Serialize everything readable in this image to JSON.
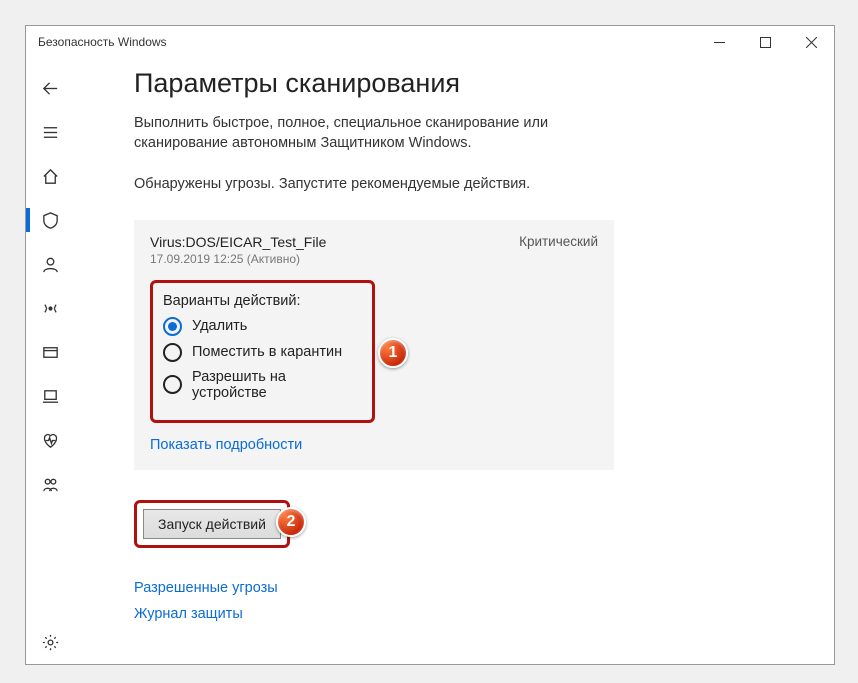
{
  "window_title": "Безопасность Windows",
  "page_title": "Параметры сканирования",
  "subtext": "Выполнить быстрое, полное, специальное сканирование или сканирование автономным Защитником Windows.",
  "status_line": "Обнаружены угрозы. Запустите рекомендуемые действия.",
  "threat": {
    "name": "Virus:DOS/EICAR_Test_File",
    "severity": "Критический",
    "timestamp": "17.09.2019 12:25 (Активно)",
    "actions_title": "Варианты действий:",
    "options": [
      "Удалить",
      "Поместить в карантин",
      "Разрешить на устройстве"
    ],
    "selected_index": 0,
    "details_link": "Показать подробности"
  },
  "run_actions_label": "Запуск действий",
  "bottom_links": [
    "Разрешенные угрозы",
    "Журнал защиты"
  ],
  "callouts": {
    "one": "1",
    "two": "2"
  }
}
